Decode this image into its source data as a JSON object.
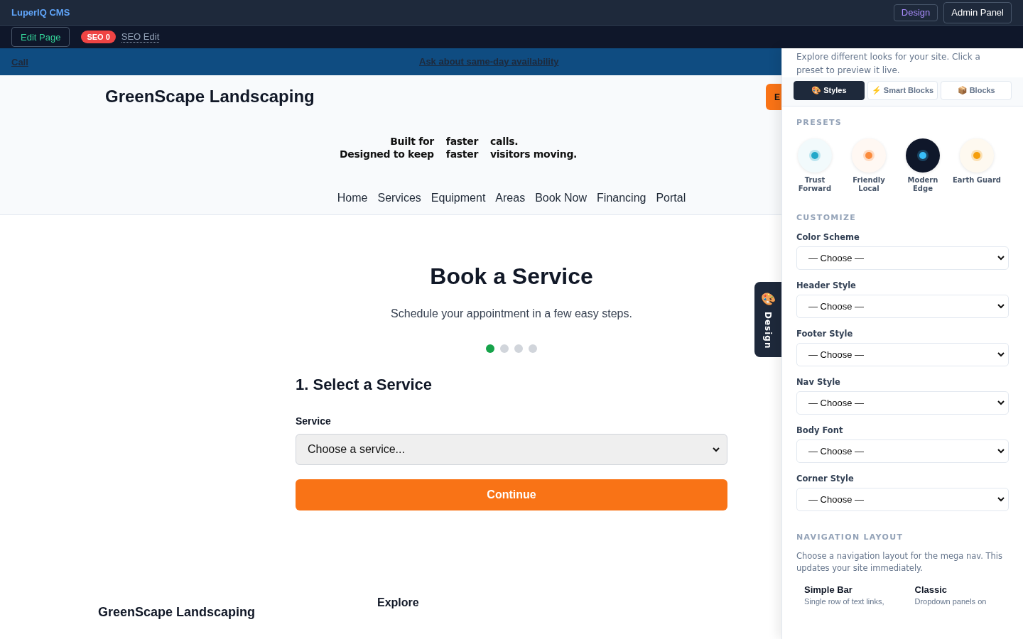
{
  "cms_bar": {
    "brand": "LuperIQ CMS",
    "design_button": "Design",
    "admin_button": "Admin Panel"
  },
  "edit_bar": {
    "edit_button": "Edit Page",
    "seo_badge": "SEO 0",
    "seo_link": "SEO Edit"
  },
  "announcement": {
    "call_link": "Call",
    "message_link": "Ask about same-day availability"
  },
  "site_header": {
    "logo": "GreenScape Landscaping",
    "cta_button": "E",
    "tagline": [
      {
        "parts": [
          "Built for",
          "faster",
          "calls."
        ]
      },
      {
        "parts": [
          "Designed to keep",
          "faster",
          "visitors moving."
        ]
      }
    ],
    "nav": [
      "Home",
      "Services",
      "Equipment",
      "Areas",
      "Book Now",
      "Financing",
      "Portal"
    ]
  },
  "booking": {
    "title": "Book a Service",
    "subtitle": "Schedule your appointment in a few easy steps.",
    "steps": [
      {
        "selected": true
      },
      {
        "selected": false
      },
      {
        "selected": false
      },
      {
        "selected": false
      }
    ],
    "step_title": "1. Select a Service",
    "field_label": "Service",
    "field_value": "Choose a service...",
    "continue_button": "Continue"
  },
  "footer": {
    "logo": "GreenScape Landscaping",
    "column_heading": "Explore"
  },
  "design_tab": {
    "label": "Design"
  },
  "design_panel": {
    "intro": "Explore different looks for your site. Click a preset to preview it live.",
    "tabs": [
      {
        "icon": "🎨",
        "label": "Styles",
        "selected": true
      },
      {
        "icon": "⚡",
        "label": "Smart Blocks",
        "selected": false
      },
      {
        "icon": "📦",
        "label": "Blocks",
        "selected": false
      }
    ],
    "presets_heading": "PRESETS",
    "presets": [
      {
        "name": "Trust Forward",
        "kind": "light",
        "color": "#22a7c9"
      },
      {
        "name": "Friendly Local",
        "kind": "light",
        "color": "#fb8b3c"
      },
      {
        "name": "Modern Edge",
        "kind": "dark",
        "color": "#38bdf8"
      },
      {
        "name": "Earth Guard",
        "kind": "light",
        "color": "#f59e0b"
      }
    ],
    "customize_heading": "CUSTOMIZE",
    "fields": [
      {
        "label": "Color Scheme",
        "value": "— Choose —"
      },
      {
        "label": "Header Style",
        "value": "— Choose —"
      },
      {
        "label": "Footer Style",
        "value": "— Choose —"
      },
      {
        "label": "Nav Style",
        "value": "— Choose —"
      },
      {
        "label": "Body Font",
        "value": "— Choose —"
      },
      {
        "label": "Corner Style",
        "value": "— Choose —"
      }
    ],
    "nav_layout_heading": "NAVIGATION LAYOUT",
    "nav_layout_text": "Choose a navigation layout for the mega nav. This updates your site immediately.",
    "nav_layouts": [
      {
        "name": "Simple Bar",
        "description": "Single row of text links,"
      },
      {
        "name": "Classic",
        "description": "Dropdown panels on"
      }
    ]
  }
}
